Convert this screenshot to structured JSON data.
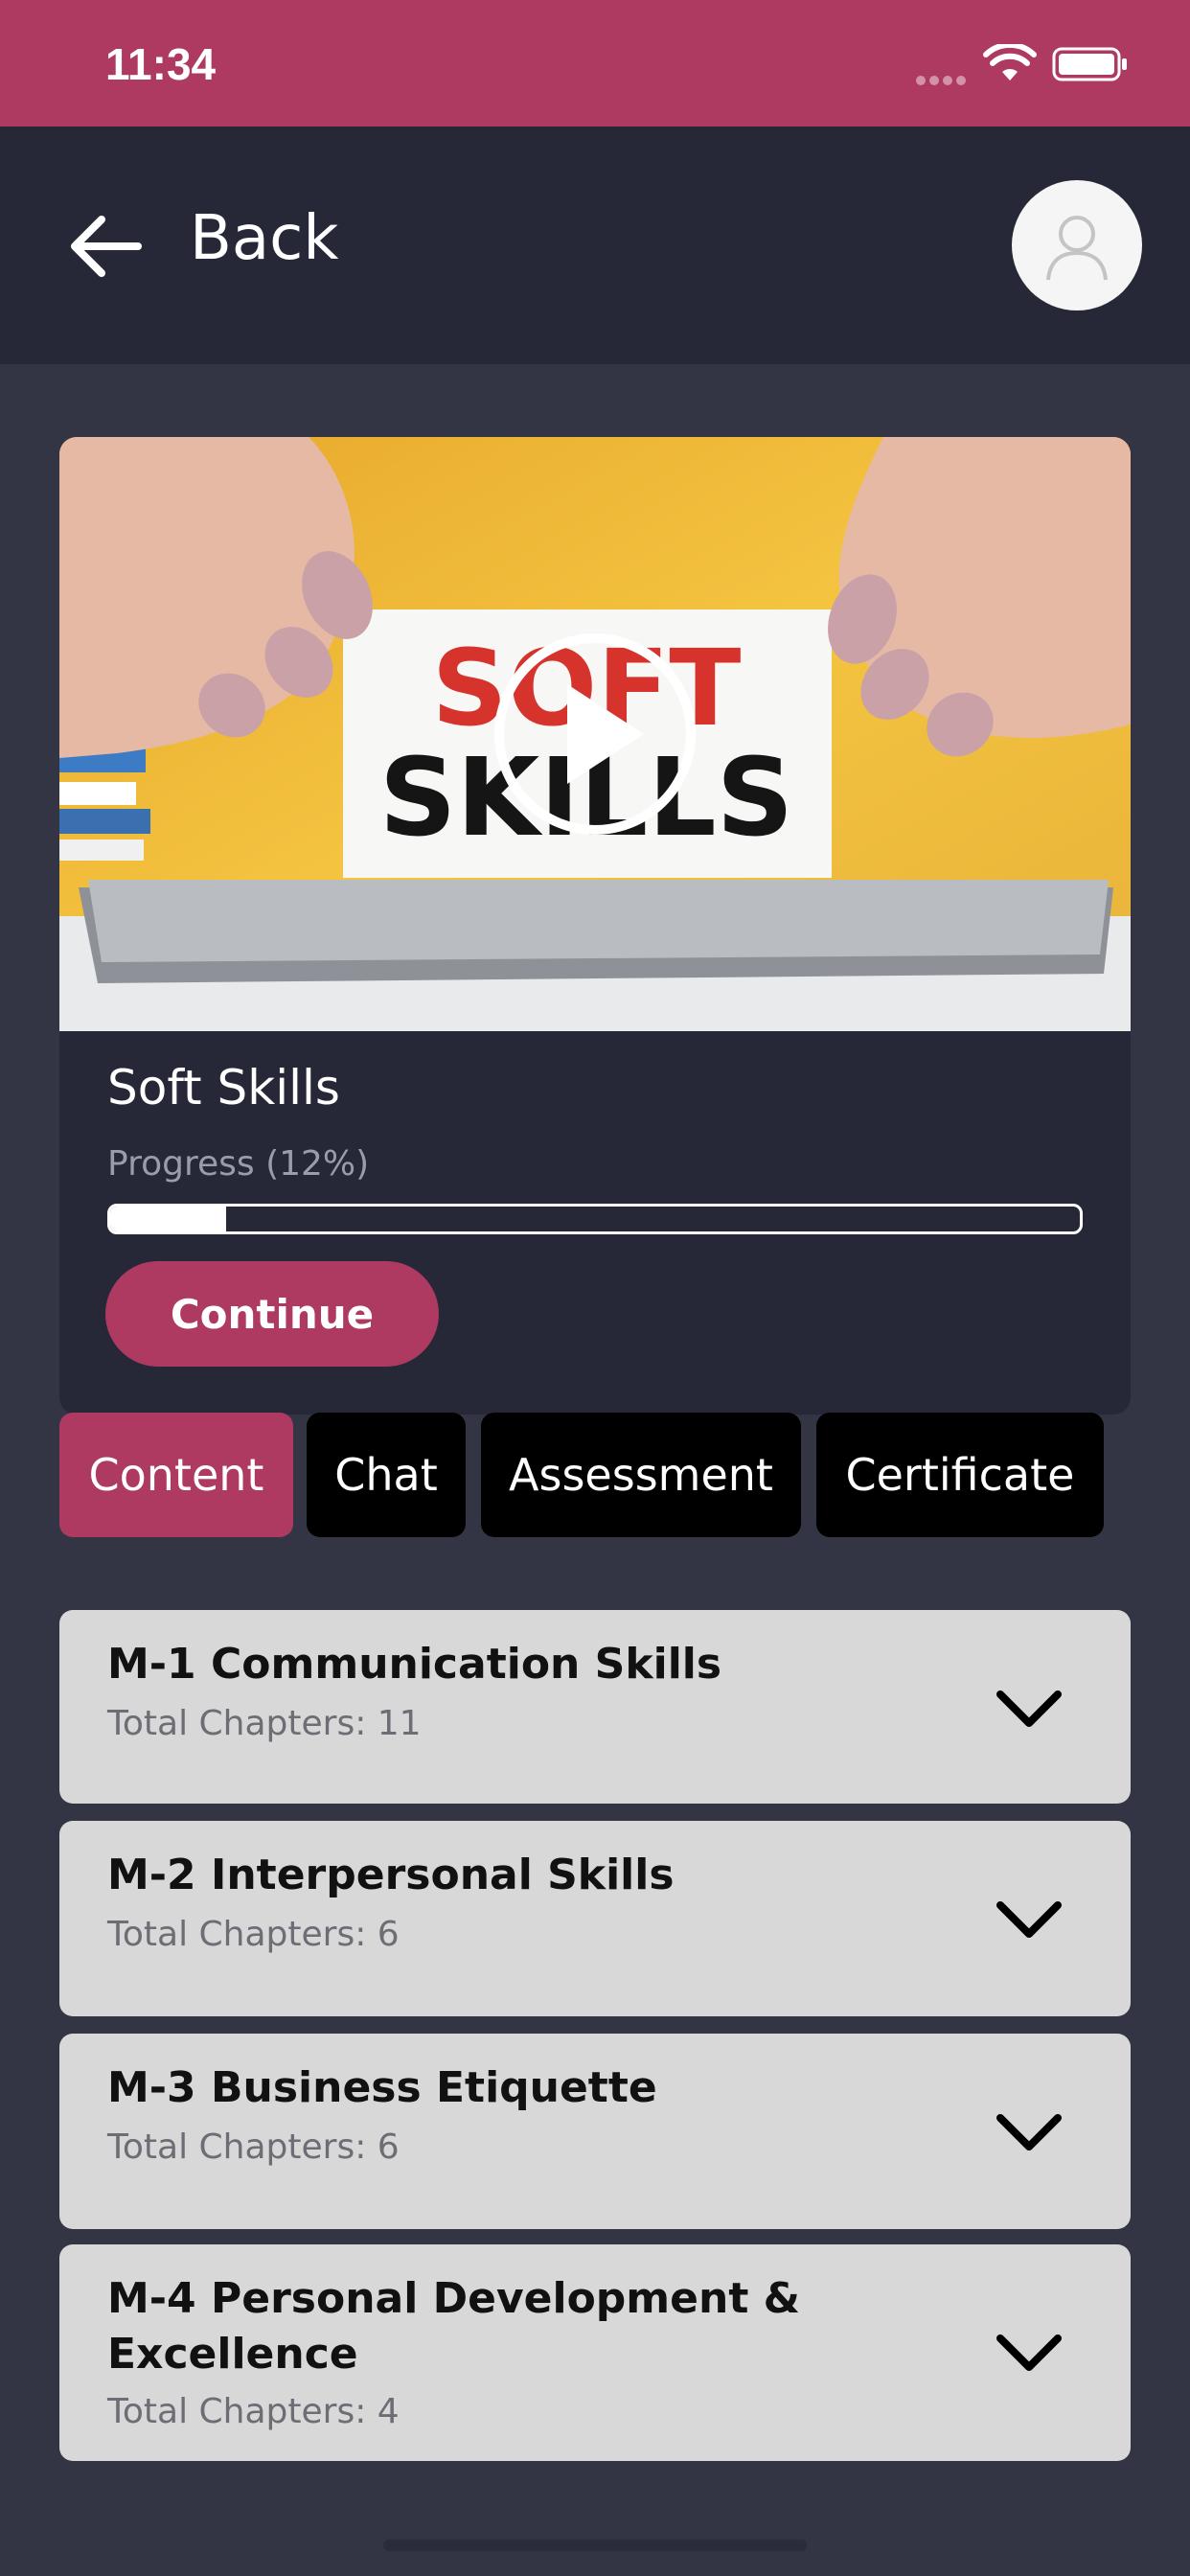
{
  "status_bar": {
    "time": "11:34",
    "icons": [
      "signal-dots-icon",
      "wifi-icon",
      "battery-icon"
    ]
  },
  "header": {
    "back_label": "Back",
    "back_icon": "arrow-left-icon",
    "avatar_icon": "user-avatar-icon"
  },
  "course": {
    "image_text_line1": "SOFT",
    "image_text_line2": "SKILLS",
    "title": "Soft Skills",
    "progress_label": "Progress (12%)",
    "progress_fraction": 0.12,
    "continue_label": "Continue"
  },
  "tabs": [
    {
      "label": "Content",
      "active": true
    },
    {
      "label": "Chat",
      "active": false
    },
    {
      "label": "Assessment",
      "active": false
    },
    {
      "label": "Certificate",
      "active": false
    }
  ],
  "modules": [
    {
      "title": "M-1 Communication Skills",
      "chapters": "Total Chapters: 11"
    },
    {
      "title": "M-2 Interpersonal Skills",
      "chapters": "Total Chapters: 6"
    },
    {
      "title": "M-3 Business Etiquette",
      "chapters": "Total Chapters: 6"
    },
    {
      "title": "M-4 Personal Development & Excellence",
      "chapters": "Total Chapters: 4"
    }
  ],
  "colors": {
    "accent": "#ae3a62",
    "header": "#262838",
    "background": "#333545",
    "module_bg": "#d8d8d8"
  }
}
